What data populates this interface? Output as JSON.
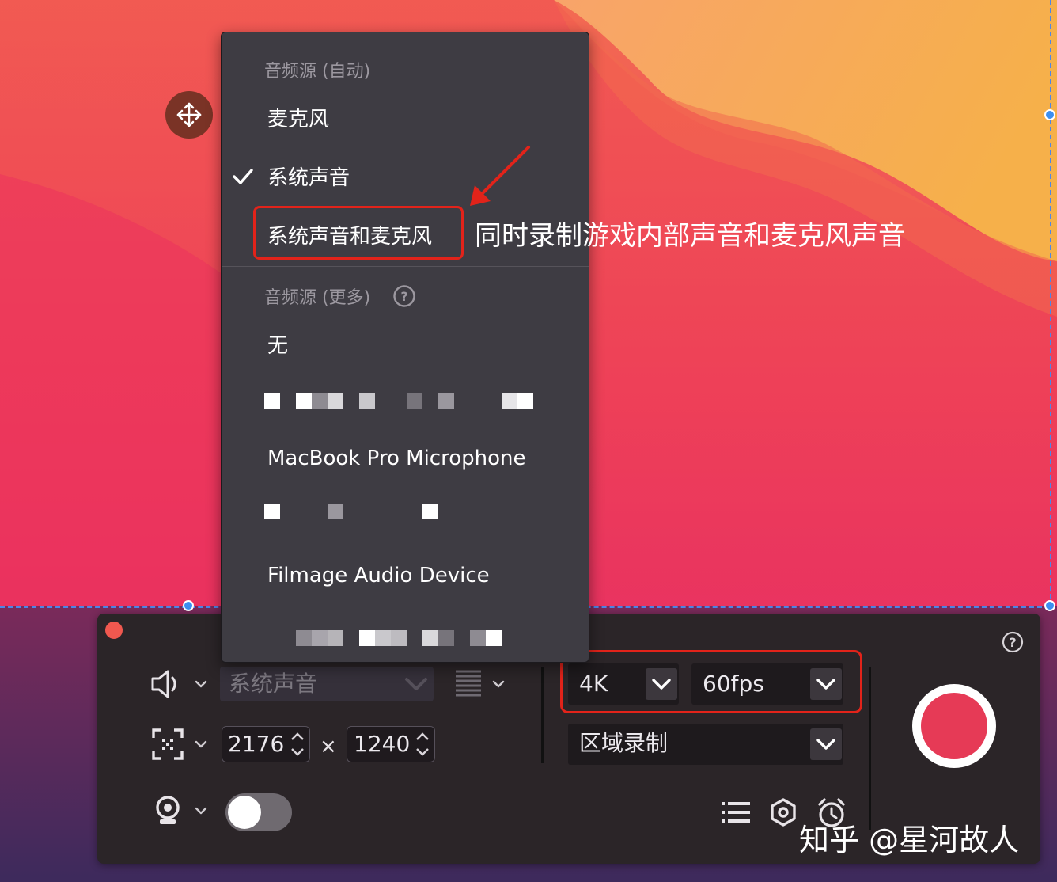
{
  "menu": {
    "section_auto": "音频源 (自动)",
    "item_microphone": "麦克风",
    "item_system_sound": "系统声音",
    "item_system_and_mic": "系统声音和麦克风",
    "section_more": "音频源 (更多)",
    "item_none": "无",
    "item_macbook_mic": "MacBook Pro Microphone",
    "item_filmage": "Filmage Audio Device",
    "selected_item": "系统声音"
  },
  "annotation": {
    "text": "同时录制游戏内部声音和麦克风声音"
  },
  "toolbar": {
    "audio_source_value": "系统声音",
    "width_value": "2176",
    "times_sign": "×",
    "height_value": "1240",
    "resolution_value": "4K",
    "fps_value": "60fps",
    "mode_value": "区域录制",
    "webcam_enabled": false
  },
  "watermark": {
    "text": "知乎 @星河故人"
  },
  "colors": {
    "record_red": "#e63a56",
    "highlight_red": "#e2231a",
    "selection_blue": "#3b8ff0"
  },
  "icons": [
    "move-icon",
    "checkmark-icon",
    "help-icon",
    "speaker-icon",
    "region-icon",
    "webcam-icon",
    "chevron-down-icon",
    "volume-bars-icon",
    "list-icon",
    "settings-icon",
    "alarm-icon"
  ]
}
